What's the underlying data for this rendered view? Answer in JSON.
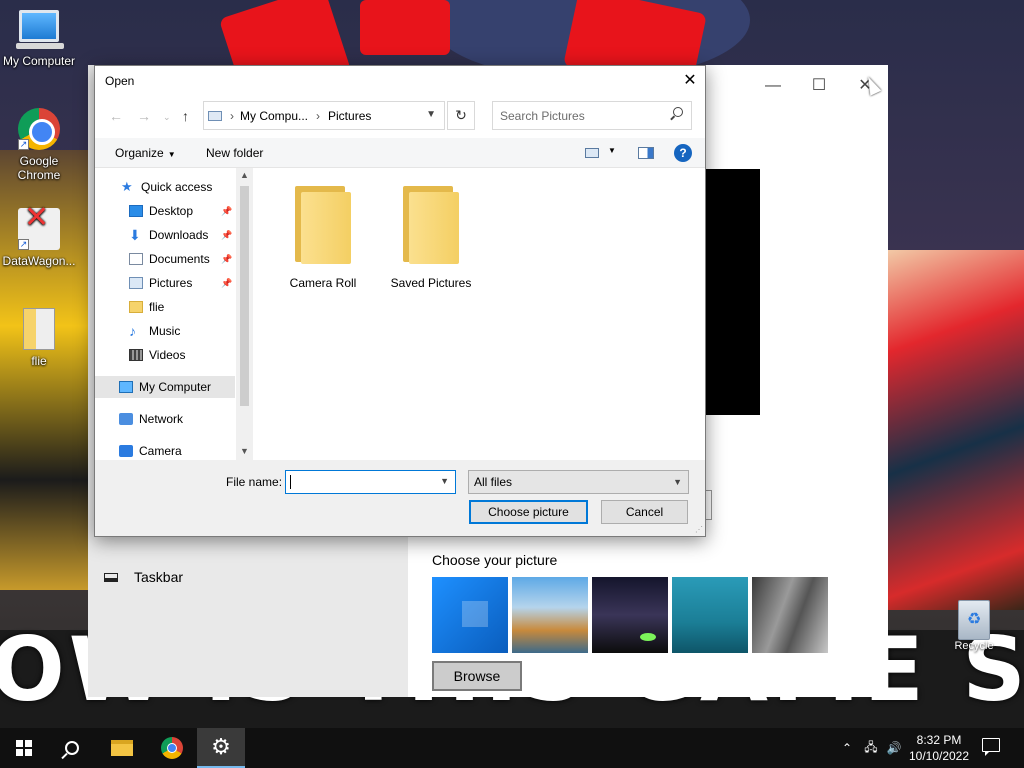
{
  "desktop": {
    "banner_text": "OW IS THIS GAME SO GOO",
    "icons": [
      {
        "label": "My Computer"
      },
      {
        "label": "Google\nChrome"
      },
      {
        "label": "DataWagon..."
      },
      {
        "label": "flie"
      }
    ],
    "recycle_bin_label": "Recycle"
  },
  "settings_window": {
    "minimize": "—",
    "maximize": "☐",
    "close": "✕",
    "nav_taskbar": "Taskbar",
    "choose_picture_label": "Choose your picture",
    "browse_label": "Browse"
  },
  "dialog": {
    "title": "Open",
    "close": "✕",
    "address": {
      "segments": [
        "My Compu...",
        "Pictures"
      ],
      "separator": "›"
    },
    "search_placeholder": "Search Pictures",
    "organize_label": "Organize",
    "new_folder_label": "New folder",
    "help": "?",
    "nav": [
      {
        "label": "Quick access",
        "icon": "star-icon"
      },
      {
        "label": "Desktop",
        "icon": "desktop-icon",
        "pinned": true
      },
      {
        "label": "Downloads",
        "icon": "downloads-icon",
        "pinned": true
      },
      {
        "label": "Documents",
        "icon": "documents-icon",
        "pinned": true
      },
      {
        "label": "Pictures",
        "icon": "pictures-icon",
        "pinned": true
      },
      {
        "label": "flie",
        "icon": "folder-icon"
      },
      {
        "label": "Music",
        "icon": "music-icon"
      },
      {
        "label": "Videos",
        "icon": "videos-icon"
      },
      {
        "label": "My Computer",
        "icon": "computer-icon",
        "selected": true
      },
      {
        "label": "Network",
        "icon": "network-icon"
      },
      {
        "label": "Camera",
        "icon": "camera-icon"
      }
    ],
    "files": [
      {
        "name": "Camera Roll"
      },
      {
        "name": "Saved Pictures"
      }
    ],
    "file_name_label": "File name:",
    "file_name_value": "",
    "filter_value": "All files",
    "choose_button": "Choose picture",
    "cancel_button": "Cancel"
  },
  "taskbar": {
    "time": "8:32 PM",
    "date": "10/10/2022"
  },
  "colors": {
    "accent": "#0078d7",
    "taskbar": "#101010"
  }
}
